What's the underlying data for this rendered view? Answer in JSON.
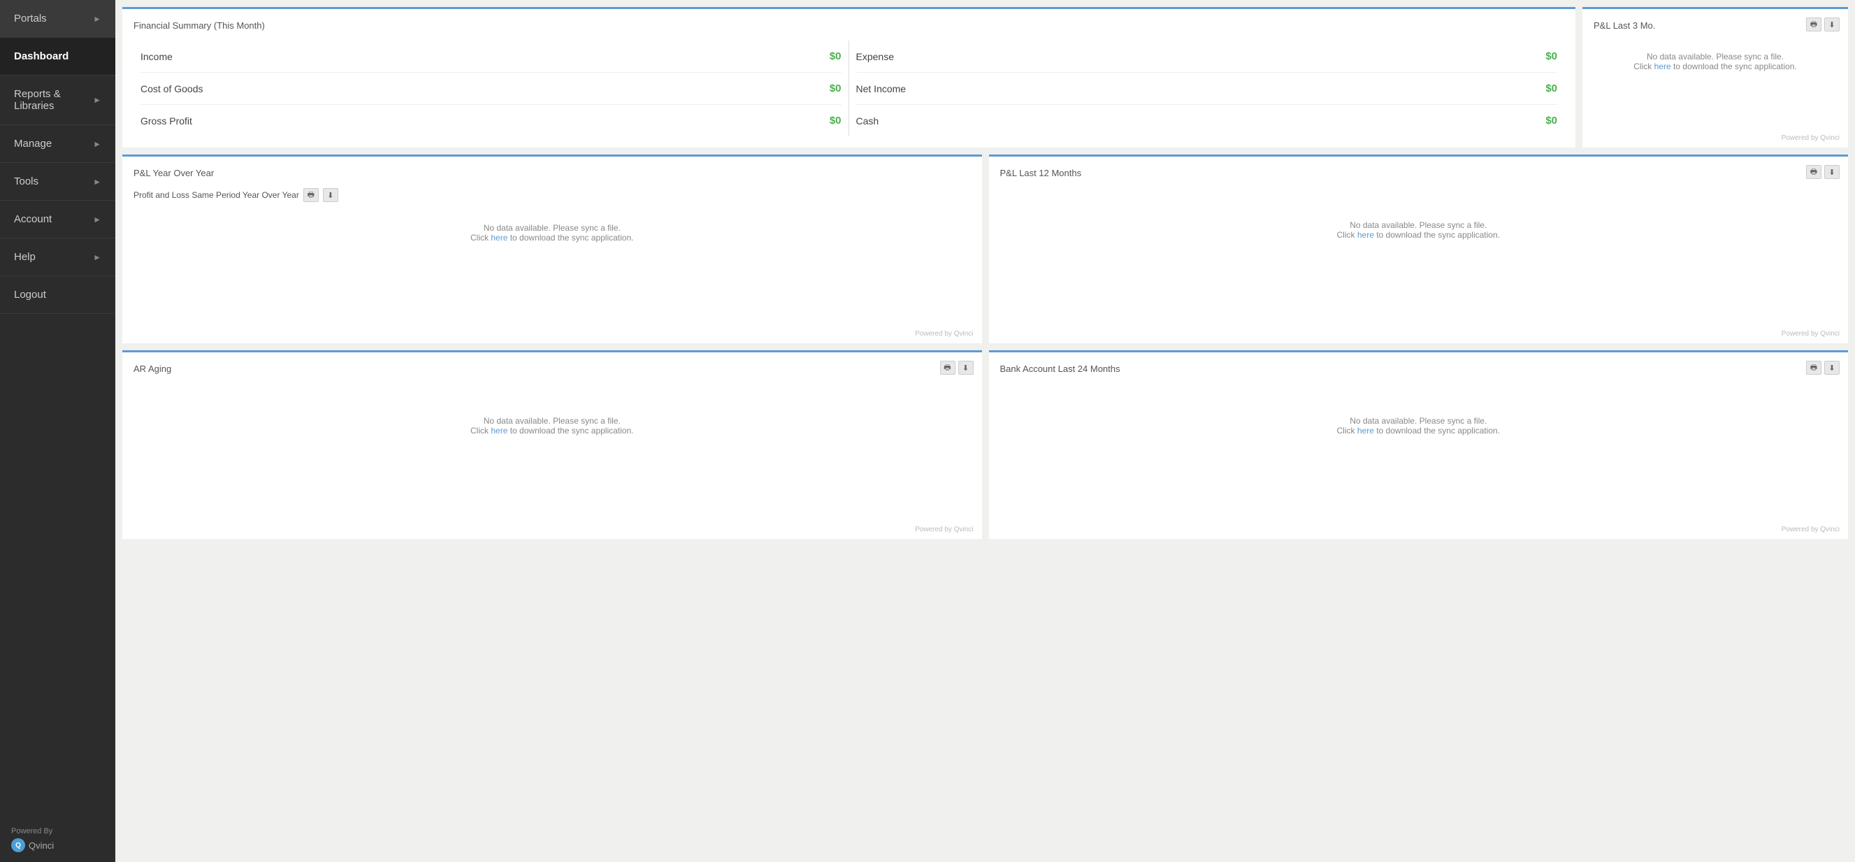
{
  "sidebar": {
    "items": [
      {
        "label": "Portals",
        "has_arrow": true,
        "active": false,
        "id": "portals"
      },
      {
        "label": "Dashboard",
        "has_arrow": false,
        "active": true,
        "id": "dashboard"
      },
      {
        "label": "Reports & Libraries",
        "has_arrow": true,
        "active": false,
        "id": "reports-libraries"
      },
      {
        "label": "Manage",
        "has_arrow": true,
        "active": false,
        "id": "manage"
      },
      {
        "label": "Tools",
        "has_arrow": true,
        "active": false,
        "id": "tools"
      },
      {
        "label": "Account",
        "has_arrow": true,
        "active": false,
        "id": "account"
      },
      {
        "label": "Help",
        "has_arrow": true,
        "active": false,
        "id": "help"
      },
      {
        "label": "Logout",
        "has_arrow": false,
        "active": false,
        "id": "logout"
      }
    ],
    "powered_by_label": "Powered By",
    "brand_name": "Qvinci"
  },
  "financial_summary": {
    "title": "Financial Summary (This Month)",
    "rows_left": [
      {
        "label": "Income",
        "value": "$0"
      },
      {
        "label": "Cost of Goods",
        "value": "$0"
      },
      {
        "label": "Gross Profit",
        "value": "$0"
      }
    ],
    "rows_right": [
      {
        "label": "Expense",
        "value": "$0"
      },
      {
        "label": "Net Income",
        "value": "$0"
      },
      {
        "label": "Cash",
        "value": "$0"
      }
    ]
  },
  "pl_last_3mo": {
    "title": "P&L Last 3 Mo.",
    "no_data": "No data available. Please sync a file.",
    "sync_link_text": "here",
    "sync_text_before": "Click ",
    "sync_text_after": " to download the sync application.",
    "powered_by": "Powered by Qvinci"
  },
  "pl_yoy": {
    "title": "P&L Year Over Year",
    "chart_label": "Profit and Loss Same Period Year Over Year",
    "no_data": "No data available. Please sync a file.",
    "sync_link_text": "here",
    "sync_text_before": "Click ",
    "sync_text_after": " to download the sync application.",
    "powered_by": "Powered by Qvinci"
  },
  "pl_last_12mo": {
    "title": "P&L Last 12 Months",
    "no_data": "No data available. Please sync a file.",
    "sync_link_text": "here",
    "sync_text_before": "Click ",
    "sync_text_after": " to download the sync application.",
    "powered_by": "Powered by Qvinci"
  },
  "ar_aging": {
    "title": "AR Aging",
    "no_data": "No data available. Please sync a file.",
    "sync_link_text": "here",
    "sync_text_before": "Click ",
    "sync_text_after": " to download the sync application.",
    "powered_by": "Powered by Qvinci"
  },
  "bank_account": {
    "title": "Bank Account Last 24 Months",
    "no_data": "No data available. Please sync a file.",
    "sync_link_text": "here",
    "sync_text_before": "Click ",
    "sync_text_after": " to download the sync application.",
    "powered_by": "Powered by Qvinci"
  }
}
